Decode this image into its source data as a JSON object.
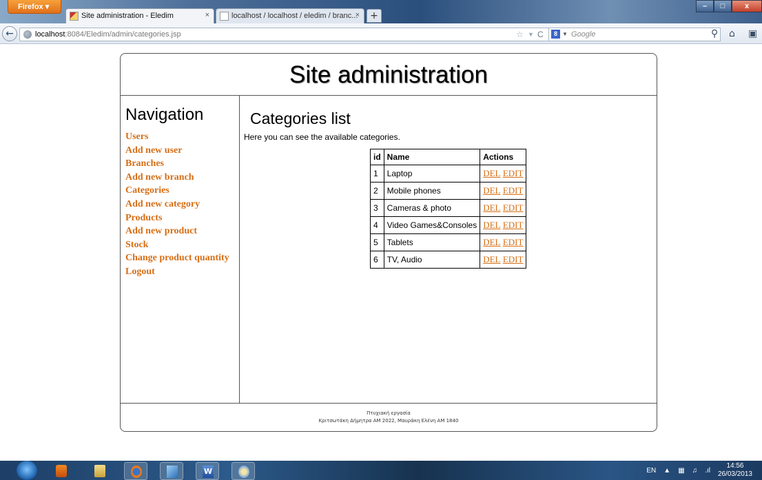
{
  "browser": {
    "menu_button": "Firefox ▾",
    "tabs": [
      {
        "label": "Site administration - Eledim",
        "close": "×"
      },
      {
        "label": "localhost / localhost / eledim / branc...",
        "close": "×"
      }
    ],
    "new_tab": "+",
    "window_buttons": {
      "minimize": "–",
      "maximize": "□",
      "close": "x"
    },
    "url": {
      "host": "localhost",
      "path": ":8084/Eledim/admin/categories.jsp"
    },
    "search_placeholder": "Google",
    "search_engine": "8"
  },
  "page": {
    "header_title": "Site administration",
    "navigation": {
      "title": "Navigation",
      "links": [
        "Users",
        "Add new user",
        "Branches",
        "Add new branch",
        "Categories",
        "Add new category",
        "Products",
        "Add new product",
        "Stock",
        "Change product quantity",
        "Logout"
      ]
    },
    "main": {
      "title": "Categories list",
      "intro": "Here you can see the available categories.",
      "table": {
        "headers": [
          "id",
          "Name",
          "Actions"
        ],
        "del_label": "DEL",
        "edit_label": "EDIT",
        "rows": [
          {
            "id": "1",
            "name": "Laptop"
          },
          {
            "id": "2",
            "name": "Mobile phones"
          },
          {
            "id": "3",
            "name": "Cameras & photo"
          },
          {
            "id": "4",
            "name": "Video Games&Consoles"
          },
          {
            "id": "5",
            "name": "Tablets"
          },
          {
            "id": "6",
            "name": "TV, Audio"
          }
        ]
      }
    },
    "footer": {
      "line1": "Πτυχιακή εργασία",
      "line2": "Κριτσωτάκη Δήμητρα ΑΜ 2022, Μαυράκη Ελένη ΑΜ 1840"
    },
    "link_color": "#d66e15"
  },
  "taskbar": {
    "language": "EN",
    "time": "14:56",
    "date": "26/03/2013"
  }
}
